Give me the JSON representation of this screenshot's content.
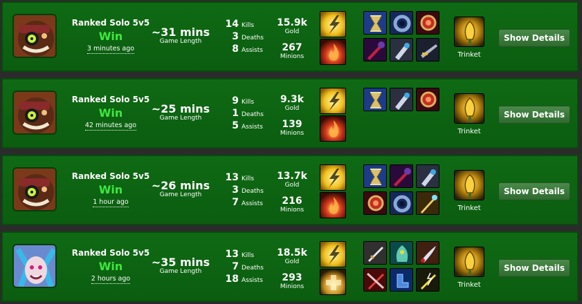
{
  "colors": {
    "row_bg": "#0f6a14",
    "win_text": "#3ee83e",
    "button_bg": "#3f7d3f"
  },
  "labels": {
    "kills": "Kills",
    "deaths": "Deaths",
    "assists": "Assists",
    "gold": "Gold",
    "minions": "Minions",
    "game_length": "Game Length",
    "trinket": "Trinket",
    "details_button": "Show Details"
  },
  "matches": [
    {
      "champion_icon": "ziggs-portrait",
      "queue": "Ranked Solo 5v5",
      "result": "Win",
      "time_ago": "3 minutes ago",
      "length": "~31 mins",
      "kills": "14",
      "deaths": "3",
      "assists": "8",
      "gold": "15.9k",
      "minions": "267",
      "spells": [
        "flash-icon",
        "ignite-icon"
      ],
      "items": [
        "zhonyas-hourglass-icon",
        "sorcerers-shoes-icon",
        "ludens-echo-icon",
        "void-staff-icon",
        "lich-bane-icon",
        "hextech-gunblade-icon"
      ],
      "trinket": "warding-totem-icon"
    },
    {
      "champion_icon": "ziggs-portrait",
      "queue": "Ranked Solo 5v5",
      "result": "Win",
      "time_ago": "42 minutes ago",
      "length": "~25 mins",
      "kills": "9",
      "deaths": "1",
      "assists": "5",
      "gold": "9.3k",
      "minions": "139",
      "spells": [
        "flash-icon",
        "ignite-icon"
      ],
      "items": [
        "zhonyas-hourglass-icon",
        "lich-bane-icon",
        "ludens-echo-icon"
      ],
      "trinket": "warding-totem-icon"
    },
    {
      "champion_icon": "ziggs-portrait",
      "queue": "Ranked Solo 5v5",
      "result": "Win",
      "time_ago": "1 hour ago",
      "length": "~26 mins",
      "kills": "13",
      "deaths": "3",
      "assists": "7",
      "gold": "13.7k",
      "minions": "216",
      "spells": [
        "flash-icon",
        "ignite-icon"
      ],
      "items": [
        "zhonyas-hourglass-icon",
        "void-staff-icon",
        "lich-bane-icon",
        "ludens-echo-icon",
        "sorcerers-shoes-icon",
        "rylais-scepter-icon"
      ],
      "trinket": "warding-totem-icon"
    },
    {
      "champion_icon": "jinx-portrait",
      "queue": "Ranked Solo 5v5",
      "result": "Win",
      "time_ago": "2 hours ago",
      "length": "~35 mins",
      "kills": "13",
      "deaths": "7",
      "assists": "18",
      "gold": "18.5k",
      "minions": "293",
      "spells": [
        "flash-icon",
        "heal-icon"
      ],
      "items": [
        "infinity-edge-icon",
        "banshees-veil-icon",
        "mercurial-scimitar-icon",
        "bloodthirster-icon",
        "berserkers-greaves-icon",
        "statikk-shiv-icon"
      ],
      "trinket": "warding-totem-icon"
    }
  ]
}
